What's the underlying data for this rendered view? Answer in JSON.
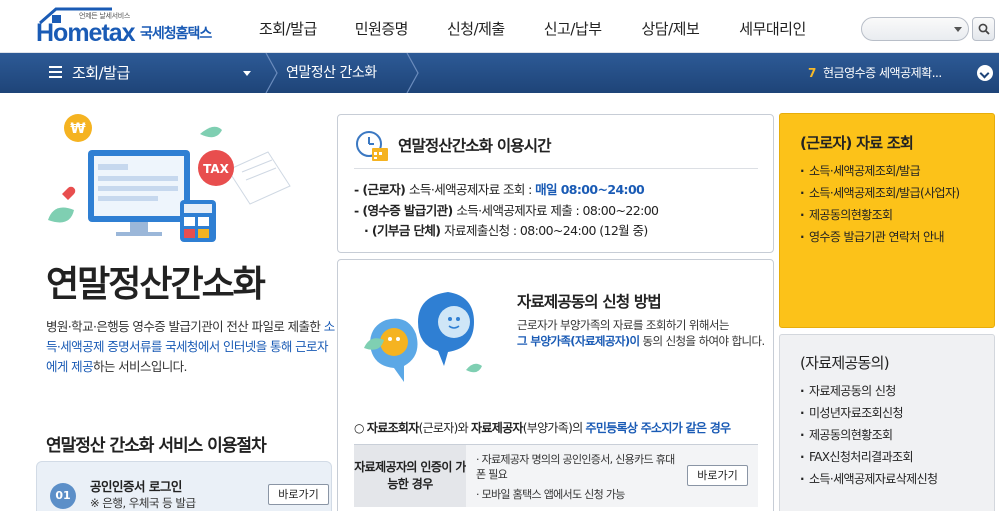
{
  "header": {
    "logo_text": "Hometax",
    "logo_tagline": "언제든 날세서비스",
    "logo_kr": "국세청홈택스",
    "nav": [
      {
        "label": "조회/발급"
      },
      {
        "label": "민원증명"
      },
      {
        "label": "신청/제출"
      },
      {
        "label": "신고/납부"
      },
      {
        "label": "상담/제보"
      },
      {
        "label": "세무대리인"
      }
    ],
    "search": {
      "placeholder": ""
    }
  },
  "breadcrumb": {
    "menu_label": "조회/발급",
    "page_label": "연말정산 간소화",
    "notice_num": "7",
    "notice_text": "현금영수증 세액공제확..."
  },
  "intro": {
    "title": "연말정산간소화",
    "desc_1": "병원·학교·은행등 영수증 발급기관이 전산 파일로 제출한 ",
    "desc_hl": "소득·세액공제 증명서류를 국세청에서 인터넷을 통해 근로자에게 제공",
    "desc_2": "하는 서비스입니다."
  },
  "procedure": {
    "title": "연말정산 간소화 서비스 이용절차",
    "step_num": "01",
    "step_title": "공인인증서 로그인",
    "step_sub": "※ 은행, 우체국 등 발급",
    "step_button": "바로가기"
  },
  "usage_time": {
    "title": "연말정산간소화 이용시간",
    "row1_prefix": "- (근로자) ",
    "row1_text": "소득·세액공제자료 조회 : ",
    "row1_time": "매일 08:00~24:00",
    "row2_prefix": "- (영수증 발급기관) ",
    "row2_text": "소득·세액공제자료 제출 : 08:00~22:00",
    "row3_prefix": "· (기부금 단체) ",
    "row3_text": "자료제출신청 : 08:00~24:00 (12월 중)"
  },
  "apply": {
    "title": "자료제공동의 신청 방법",
    "desc_1": "근로자가 부양가족의 자료를 조회하기 위해서는",
    "desc_hl": "그 부양가족(자료제공자)이",
    "desc_2": " 동의 신청을 하여야 합니다.",
    "cond_prefix": "○ ",
    "cond_b1": "자료조회자",
    "cond_t1": "(근로자)와 ",
    "cond_b2": "자료제공자",
    "cond_t2": "(부양가족)의 ",
    "cond_hl": "주민등록상 주소지가 같은 경우",
    "table_header": "자료제공자의 인증이 가능한 경우",
    "table_li1": "· 자료제공자 명의의 공인인증서, 신용카드 휴대폰 필요",
    "table_li2": "· 모바일 홈택스 앱에서도 신청 가능",
    "table_button": "바로가기"
  },
  "side_worker": {
    "title": "(근로자) 자료 조회",
    "items": [
      "소득·세액공제조회/발급",
      "소득·세액공제조회/발급(사업자)",
      "제공동의현황조회",
      "영수증 발급기관 연락처 안내"
    ]
  },
  "side_consent": {
    "title": "(자료제공동의)",
    "items": [
      "자료제공동의 신청",
      "미성년자료조회신청",
      "제공동의현황조회",
      "FAX신청처리결과조회",
      "소득·세액공제자료삭제신청"
    ]
  },
  "colors": {
    "brand_blue": "#1a5bb5",
    "nav_bar": "#1e4478",
    "accent_yellow": "#fcc219"
  }
}
